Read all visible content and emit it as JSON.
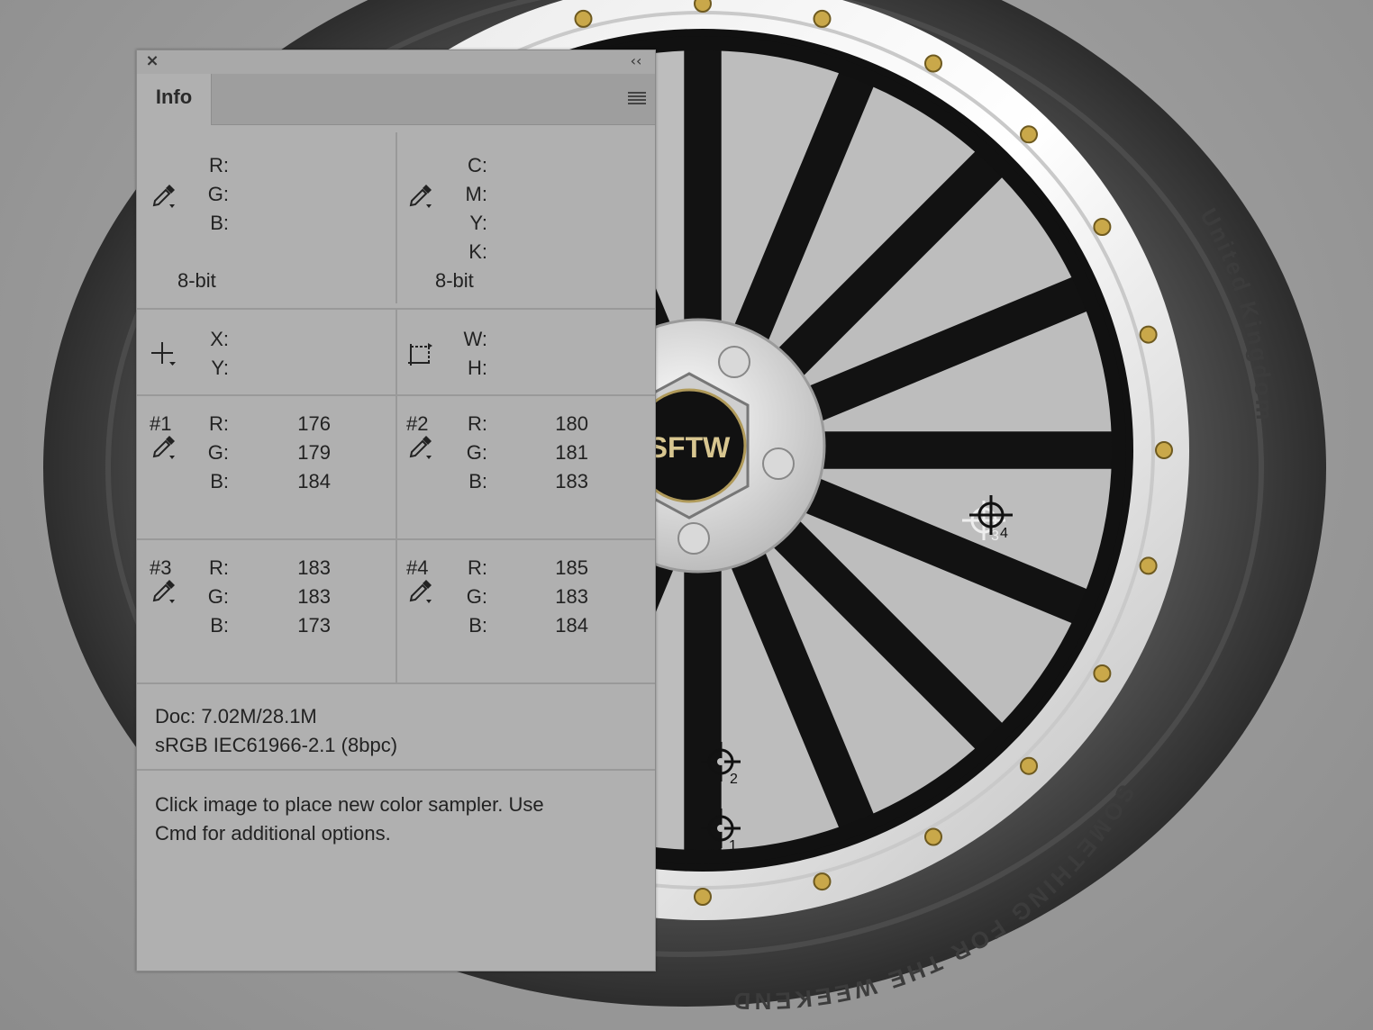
{
  "panel": {
    "title": "Info",
    "close_glyph": "×",
    "collapse_glyph": "‹‹"
  },
  "readout_color": {
    "labels": [
      "R:",
      "G:",
      "B:"
    ],
    "depth": "8-bit",
    "icon": "eyedropper-icon"
  },
  "readout_cmyk": {
    "labels": [
      "C:",
      "M:",
      "Y:",
      "K:"
    ],
    "depth": "8-bit",
    "icon": "eyedropper-icon"
  },
  "readout_xy": {
    "labels": [
      "X:",
      "Y:"
    ],
    "icon": "crosshair-icon"
  },
  "readout_wh": {
    "labels": [
      "W:",
      "H:"
    ],
    "icon": "selection-size-icon"
  },
  "samplers": [
    {
      "id": "#1",
      "labels": [
        "R:",
        "G:",
        "B:"
      ],
      "values": [
        "176",
        "179",
        "184"
      ]
    },
    {
      "id": "#2",
      "labels": [
        "R:",
        "G:",
        "B:"
      ],
      "values": [
        "180",
        "181",
        "183"
      ]
    },
    {
      "id": "#3",
      "labels": [
        "R:",
        "G:",
        "B:"
      ],
      "values": [
        "183",
        "183",
        "173"
      ]
    },
    {
      "id": "#4",
      "labels": [
        "R:",
        "G:",
        "B:"
      ],
      "values": [
        "185",
        "183",
        "184"
      ]
    }
  ],
  "doc_info": {
    "size": "Doc: 7.02M/28.1M",
    "profile": "sRGB IEC61966-2.1 (8bpc)"
  },
  "hint": {
    "line1": "Click image to place new color sampler.  Use",
    "line2": "Cmd for additional options."
  },
  "wheel": {
    "hub_text": "SFTW",
    "sidewall_text_1": "United Kingdom",
    "sidewall_text_2": "SOMETHING FOR THE WEEKEND",
    "sampler_markers": [
      "1",
      "2",
      "3",
      "4"
    ]
  }
}
